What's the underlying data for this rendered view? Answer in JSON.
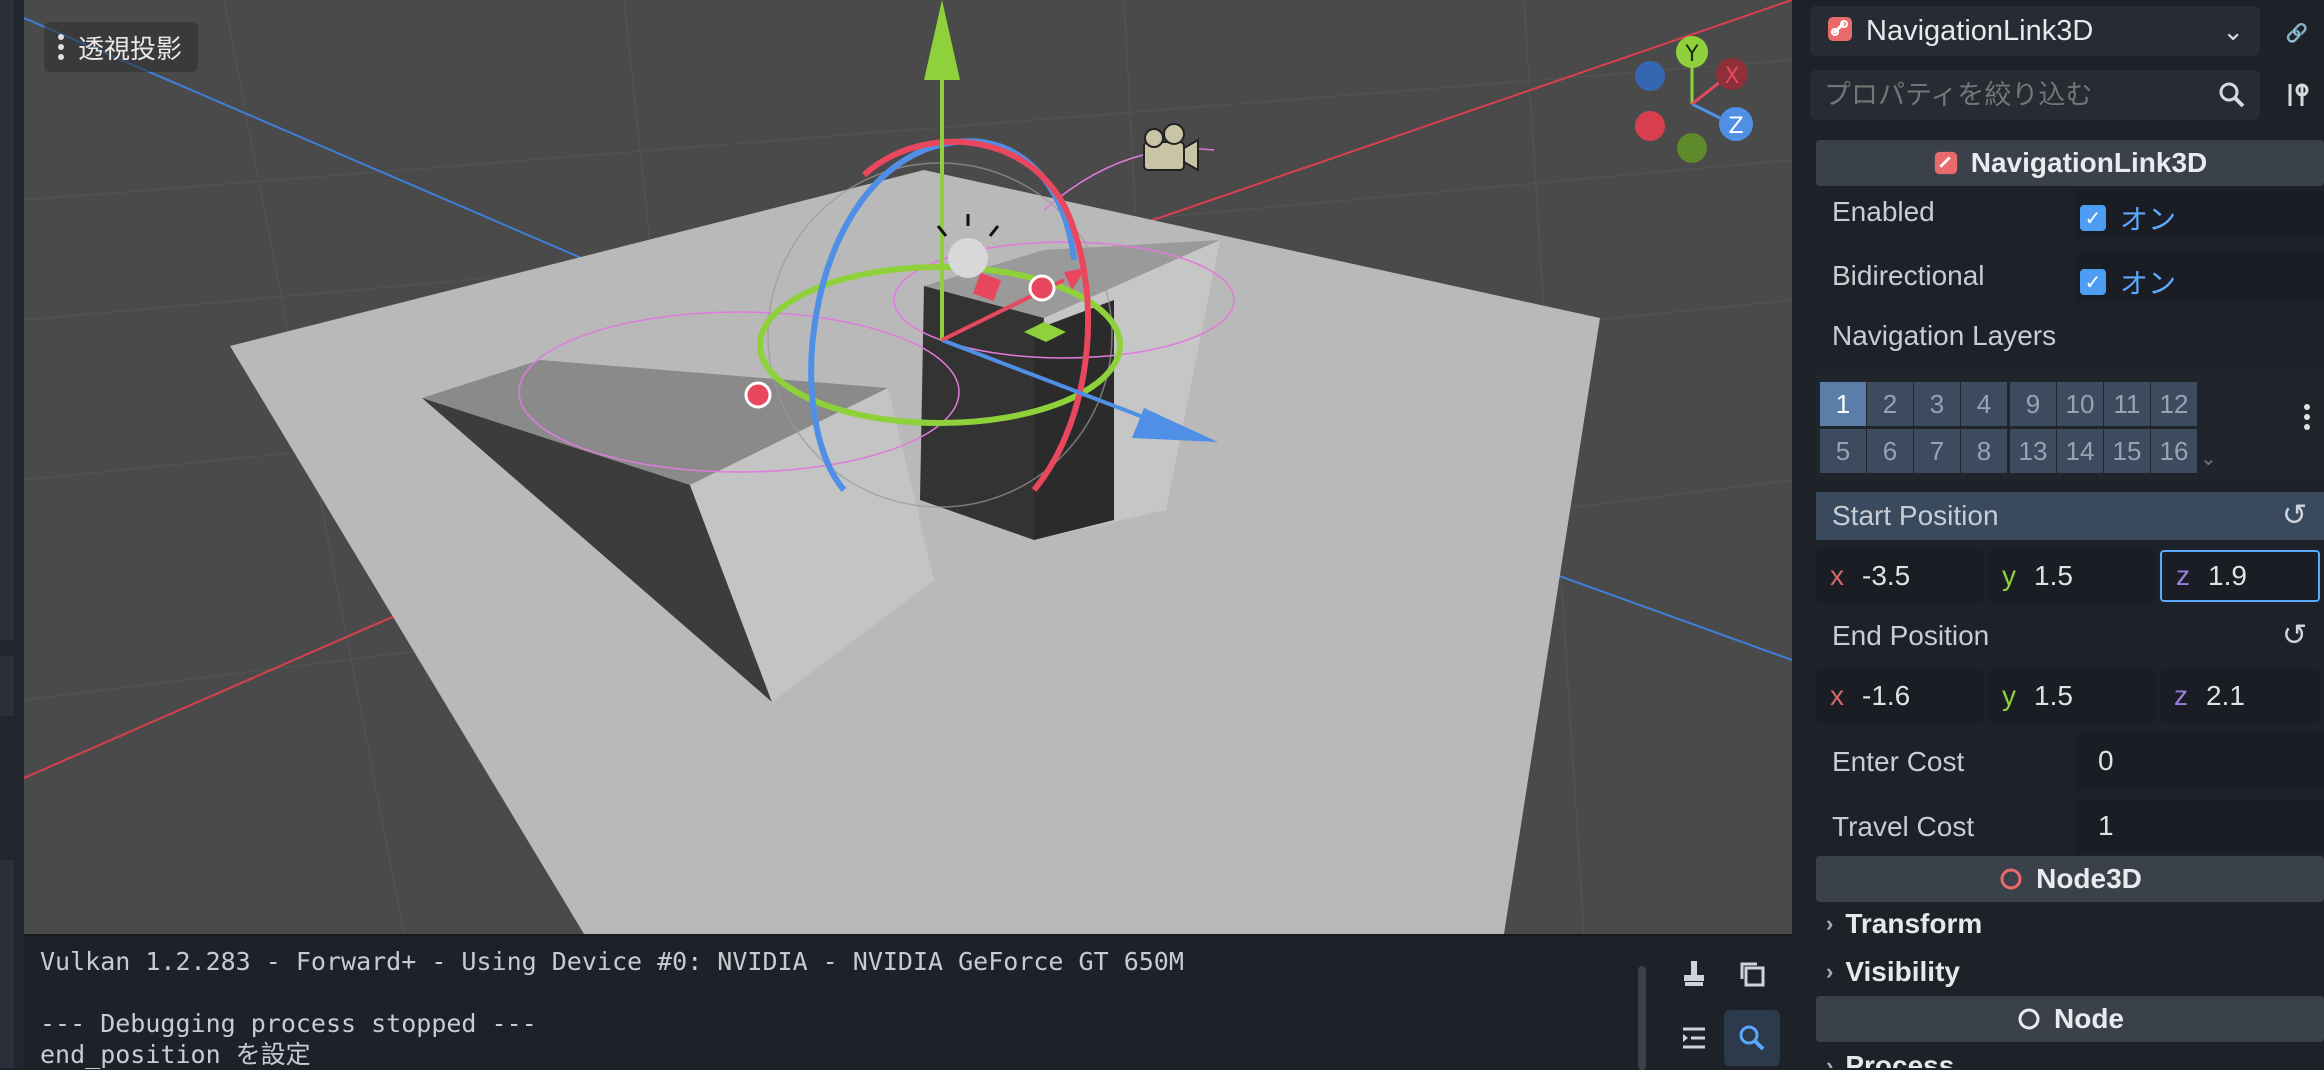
{
  "viewport": {
    "view_menu_label": "透視投影",
    "gizmo_axes": {
      "y": "Y",
      "x": "X",
      "z": "Z"
    }
  },
  "console": {
    "lines": [
      "Vulkan 1.2.283 - Forward+ - Using Device #0: NVIDIA - NVIDIA GeForce GT 650M",
      "",
      "--- Debugging process stopped ---",
      "end_position を設定"
    ]
  },
  "inspector": {
    "node_name": "NavigationLink3D",
    "filter_placeholder": "プロパティを絞り込む",
    "section_navlink": "NavigationLink3D",
    "enabled_label": "Enabled",
    "enabled_value": "オン",
    "bidirectional_label": "Bidirectional",
    "bidirectional_value": "オン",
    "nav_layers_label": "Navigation Layers",
    "layers": [
      "1",
      "2",
      "3",
      "4",
      "9",
      "10",
      "11",
      "12",
      "5",
      "6",
      "7",
      "8",
      "13",
      "14",
      "15",
      "16"
    ],
    "start_position_label": "Start Position",
    "start_position": {
      "x": "-3.5",
      "y": "1.5",
      "z": "1.9"
    },
    "end_position_label": "End Position",
    "end_position": {
      "x": "-1.6",
      "y": "1.5",
      "z": "2.1"
    },
    "axis_labels": {
      "x": "x",
      "y": "y",
      "z": "z"
    },
    "enter_cost_label": "Enter Cost",
    "enter_cost": "0",
    "travel_cost_label": "Travel Cost",
    "travel_cost": "1",
    "section_node3d": "Node3D",
    "transform_label": "Transform",
    "visibility_label": "Visibility",
    "section_node": "Node",
    "process_label": "Process"
  },
  "colors": {
    "accent": "#4e9df5",
    "axis_x": "#e8475d",
    "axis_y": "#8ed13a",
    "axis_z": "#4f8fe6"
  }
}
